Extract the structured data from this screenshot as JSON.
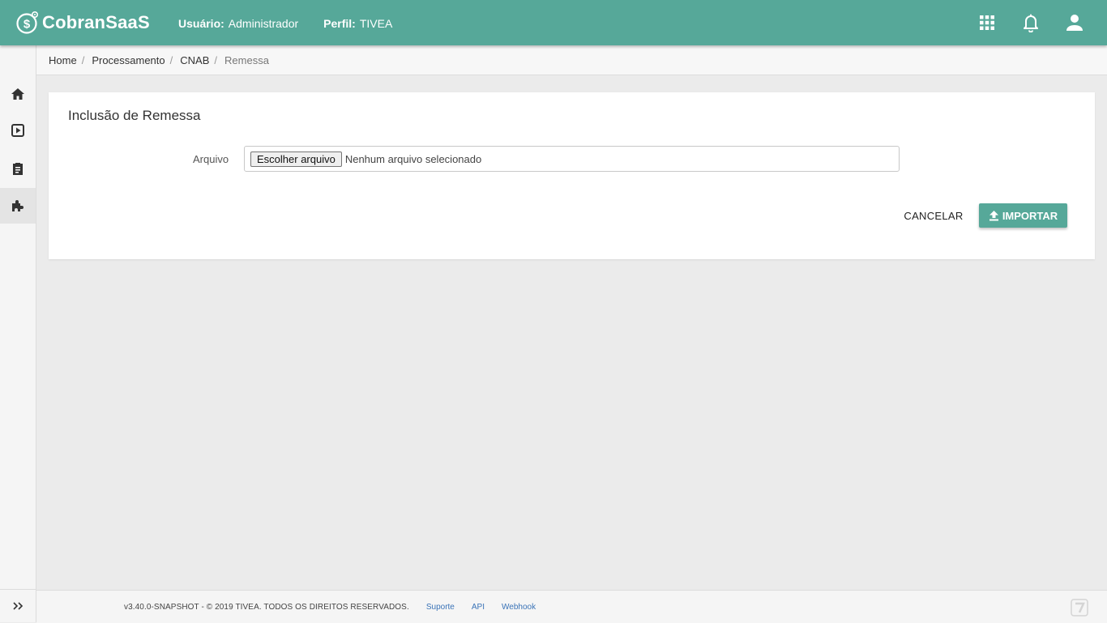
{
  "app": {
    "brand": "CobranSaaS",
    "brand_color": "#56a899"
  },
  "header": {
    "user_label": "Usuário:",
    "user_value": "Administrador",
    "profile_label": "Perfil:",
    "profile_value": "TIVEA",
    "icons": [
      "apps-grid-icon",
      "notifications-bell-icon",
      "account-icon"
    ]
  },
  "sidebar": {
    "items": [
      {
        "icon": "home-icon"
      },
      {
        "icon": "play-box-icon"
      },
      {
        "icon": "clipboard-icon"
      },
      {
        "icon": "puzzle-icon",
        "active": true
      }
    ],
    "expand_icon": "double-chevron-right-icon"
  },
  "breadcrumb": {
    "items": [
      "Home",
      "Processamento",
      "CNAB"
    ],
    "current": "Remessa"
  },
  "form": {
    "title": "Inclusão de Remessa",
    "file_label": "Arquivo",
    "choose_button": "Escolher arquivo",
    "no_file_text": "Nenhum arquivo selecionado",
    "cancel_label": "CANCELAR",
    "import_label": "IMPORTAR"
  },
  "footer": {
    "copyright": "v3.40.0-SNAPSHOT - © 2019 TIVEA. TODOS OS DIREITOS RESERVADOS.",
    "links": [
      "Suporte",
      "API",
      "Webhook"
    ]
  }
}
